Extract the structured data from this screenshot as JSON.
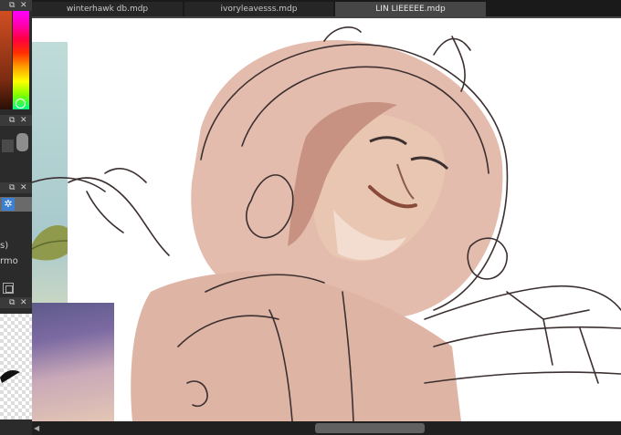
{
  "tabs": [
    {
      "label": "winterhawk db.mdp"
    },
    {
      "label": "ivoryleavesss.mdp"
    },
    {
      "label": "LIN LIEEEEE.mdp"
    }
  ],
  "panels": {
    "header_icons": [
      "float-icon",
      "close-icon"
    ],
    "layer_labels": [
      "s)",
      "rmo"
    ]
  },
  "colors": {
    "accent": "#3d7fd1",
    "skin_fill": "#d9a99a",
    "sketch_line": "#3c3030"
  }
}
